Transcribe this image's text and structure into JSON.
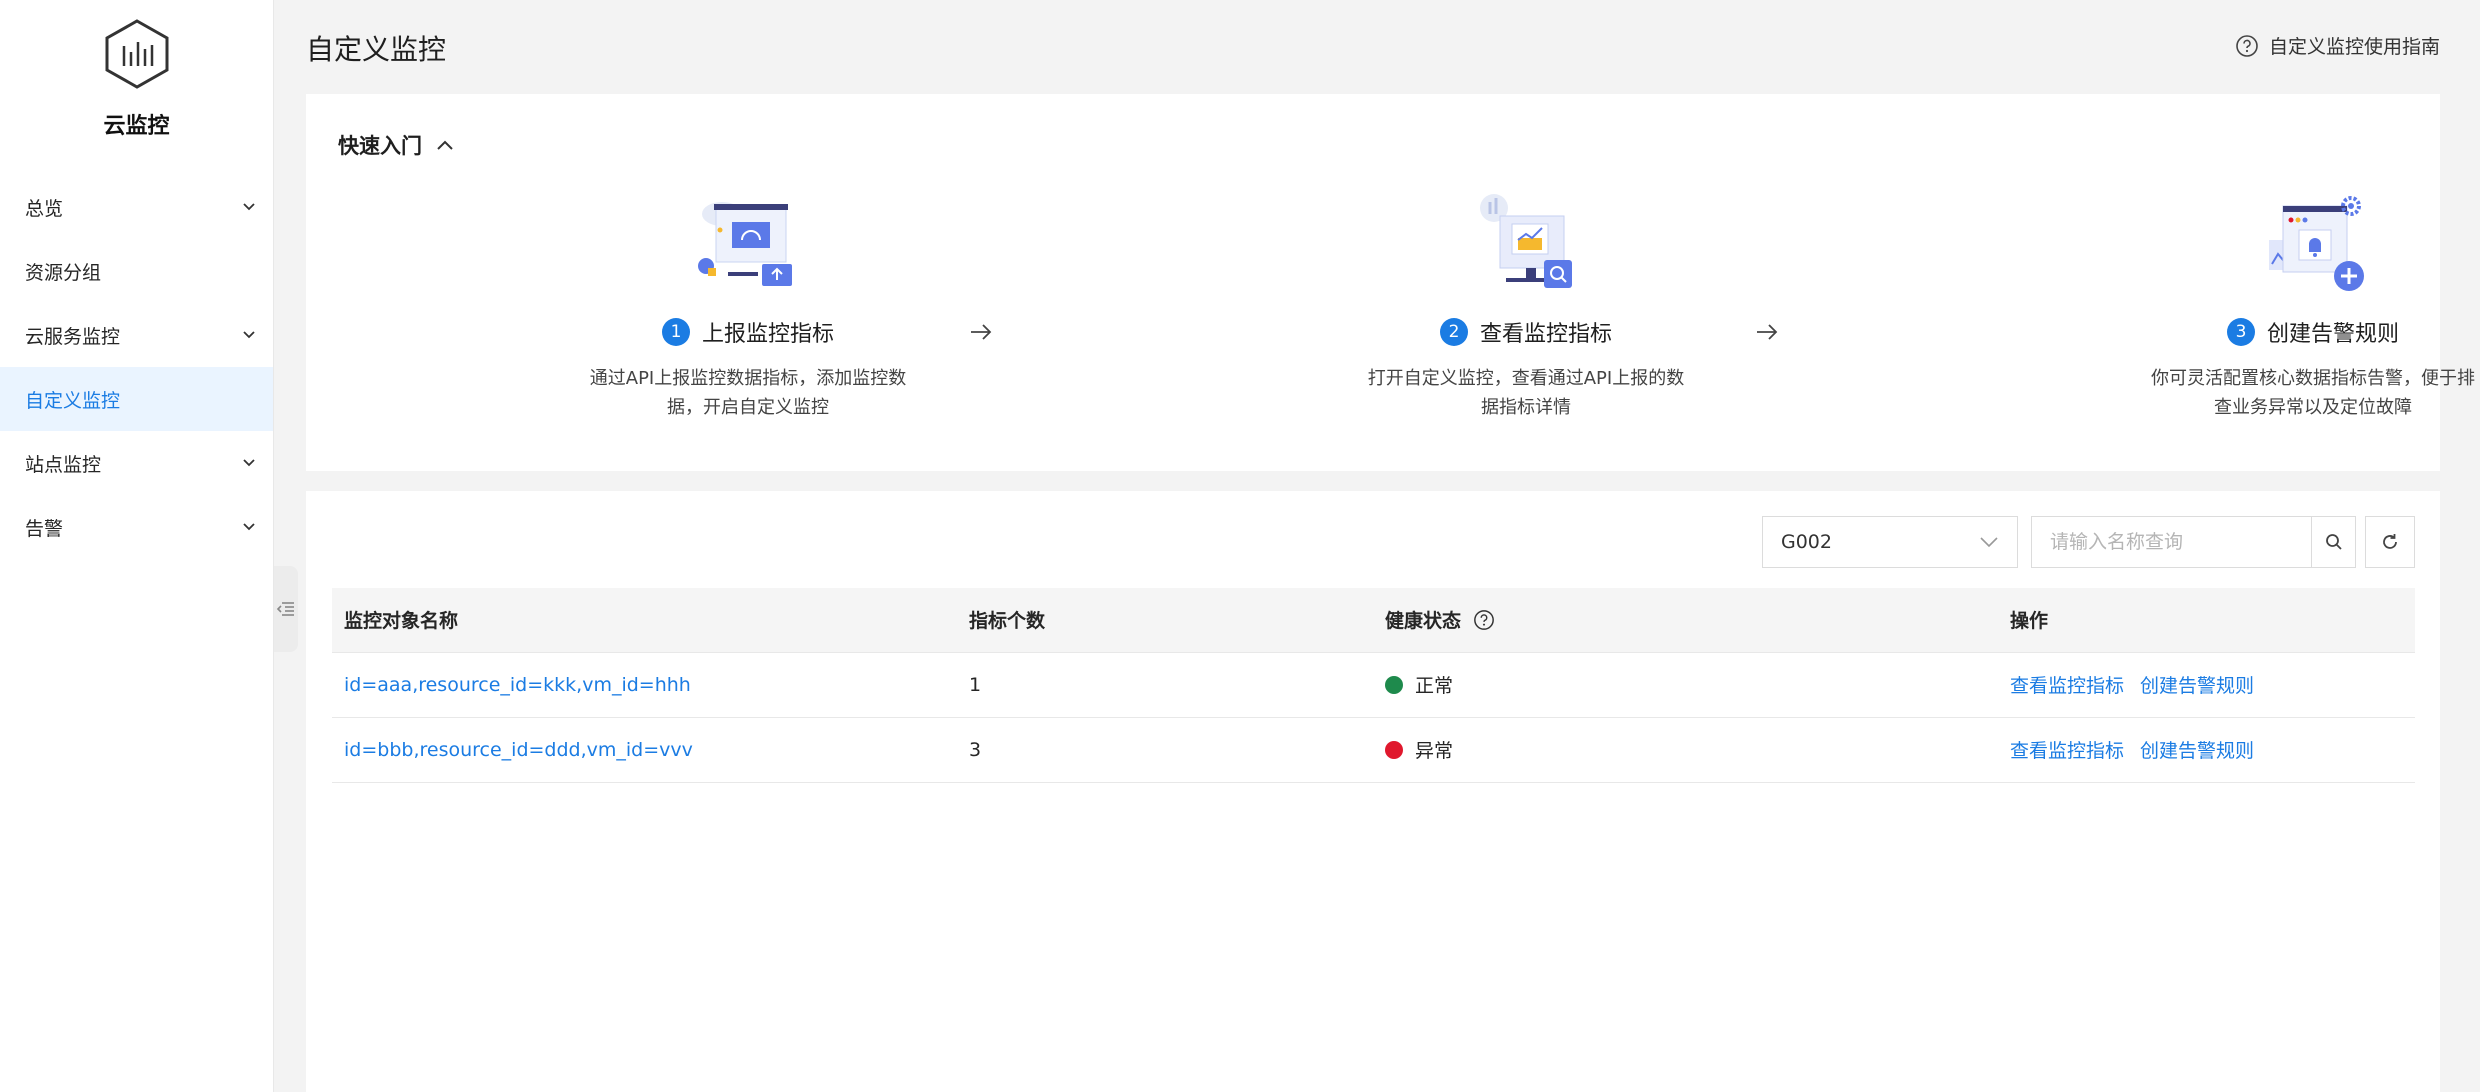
{
  "app": {
    "name": "云监控",
    "logo_icon": "cloud-monitor-logo-icon"
  },
  "sidebar": {
    "items": [
      {
        "label": "总览",
        "expandable": true,
        "active": false
      },
      {
        "label": "资源分组",
        "expandable": false,
        "active": false
      },
      {
        "label": "云服务监控",
        "expandable": true,
        "active": false
      },
      {
        "label": "自定义监控",
        "expandable": false,
        "active": true
      },
      {
        "label": "站点监控",
        "expandable": true,
        "active": false
      },
      {
        "label": "告警",
        "expandable": true,
        "active": false
      }
    ]
  },
  "header": {
    "title": "自定义监控",
    "guide_link": "自定义监控使用指南"
  },
  "quick_start": {
    "title": "快速入门",
    "steps": [
      {
        "num": "1",
        "title": "上报监控指标",
        "desc": "通过API上报监控数据指标，添加监控数据，开启自定义监控"
      },
      {
        "num": "2",
        "title": "查看监控指标",
        "desc": "打开自定义监控，查看通过API上报的数据指标详情"
      },
      {
        "num": "3",
        "title": "创建告警规则",
        "desc": "你可灵活配置核心数据指标告警，便于排查业务异常以及定位故障"
      }
    ]
  },
  "toolbar": {
    "group_select_value": "G002",
    "search_placeholder": "请输入名称查询"
  },
  "table": {
    "columns": [
      "监控对象名称",
      "指标个数",
      "健康状态",
      "操作"
    ],
    "rows": [
      {
        "name": "id=aaa,resource_id=kkk,vm_id=hhh",
        "count": "1",
        "status": "正常",
        "status_color": "#1e8a4c",
        "action_view": "查看监控指标",
        "action_alert": "创建告警规则"
      },
      {
        "name": "id=bbb,resource_id=ddd,vm_id=vvv",
        "count": "3",
        "status": "异常",
        "status_color": "#e0182d",
        "action_view": "查看监控指标",
        "action_alert": "创建告警规则"
      }
    ]
  },
  "colors": {
    "accent": "#1b7ce3",
    "active_bg": "#eaf4ff"
  }
}
